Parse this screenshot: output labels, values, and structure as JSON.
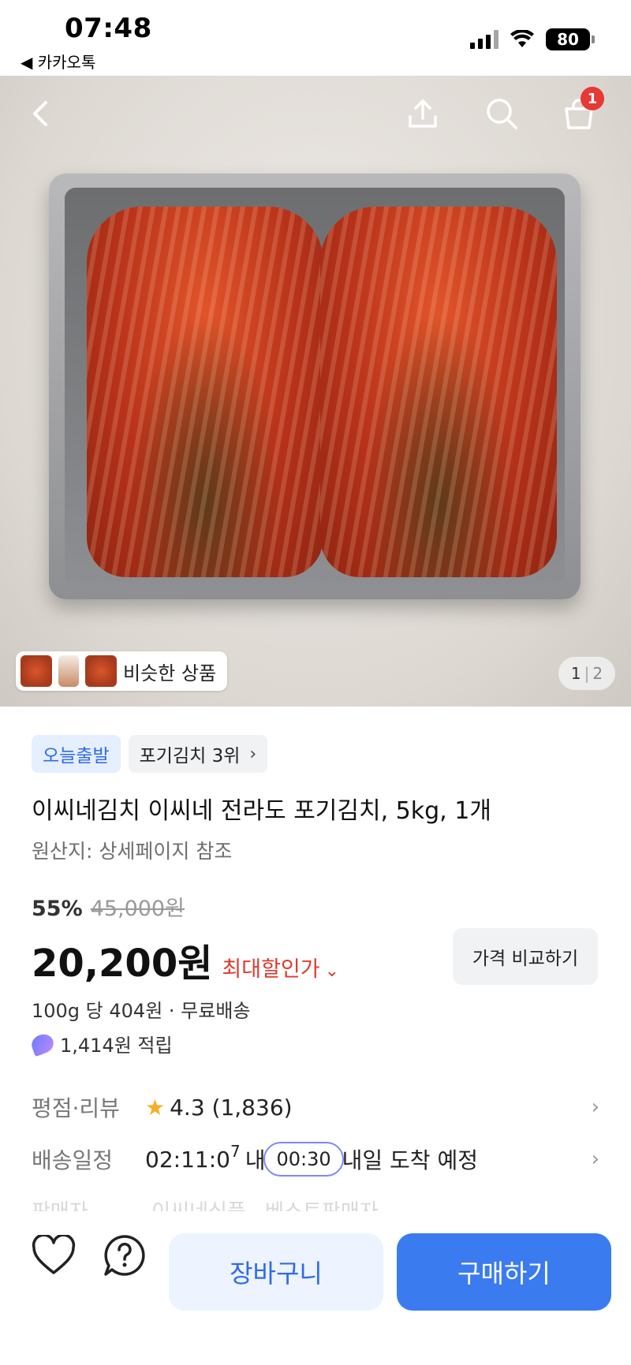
{
  "status_bar": {
    "time": "07:48",
    "back_app": "◀ 카카오톡",
    "battery": "80"
  },
  "header": {
    "cart_count": "1"
  },
  "gallery": {
    "similar_label": "비슷한 상품",
    "page_current": "1",
    "page_separator": "|",
    "page_total": "2"
  },
  "product": {
    "badge_today": "오늘출발",
    "badge_rank": "포기김치 3위",
    "title": "이씨네김치 이씨네 전라도 포기김치, 5kg, 1개",
    "origin": "원산지: 상세페이지 참조",
    "discount_rate": "55%",
    "original_price": "45,000원",
    "price": "20,200원",
    "max_discount_label": "최대할인가",
    "compare_button": "가격 비교하기",
    "unit_price": "100g 당 404원 · 무료배송",
    "points": "1,414원 적립"
  },
  "details": {
    "rating_label": "평점·리뷰",
    "rating_value": "4.3",
    "review_count": "(1,836)",
    "delivery_label": "배송일정",
    "delivery_timer": "02:11:0",
    "delivery_timer_sup": "7",
    "delivery_within": "내",
    "delivery_pill": "00:30",
    "delivery_text": "내일 도착 예정",
    "seller_label": "판매자",
    "seller_value": "이씨네식품",
    "seller_badge": "베스트판매자"
  },
  "bottom_bar": {
    "cart_button": "장바구니",
    "buy_button": "구매하기"
  },
  "colors": {
    "accent_blue": "#3b7bf0",
    "discount_red": "#e03a2f",
    "badge_red": "#e53935"
  }
}
